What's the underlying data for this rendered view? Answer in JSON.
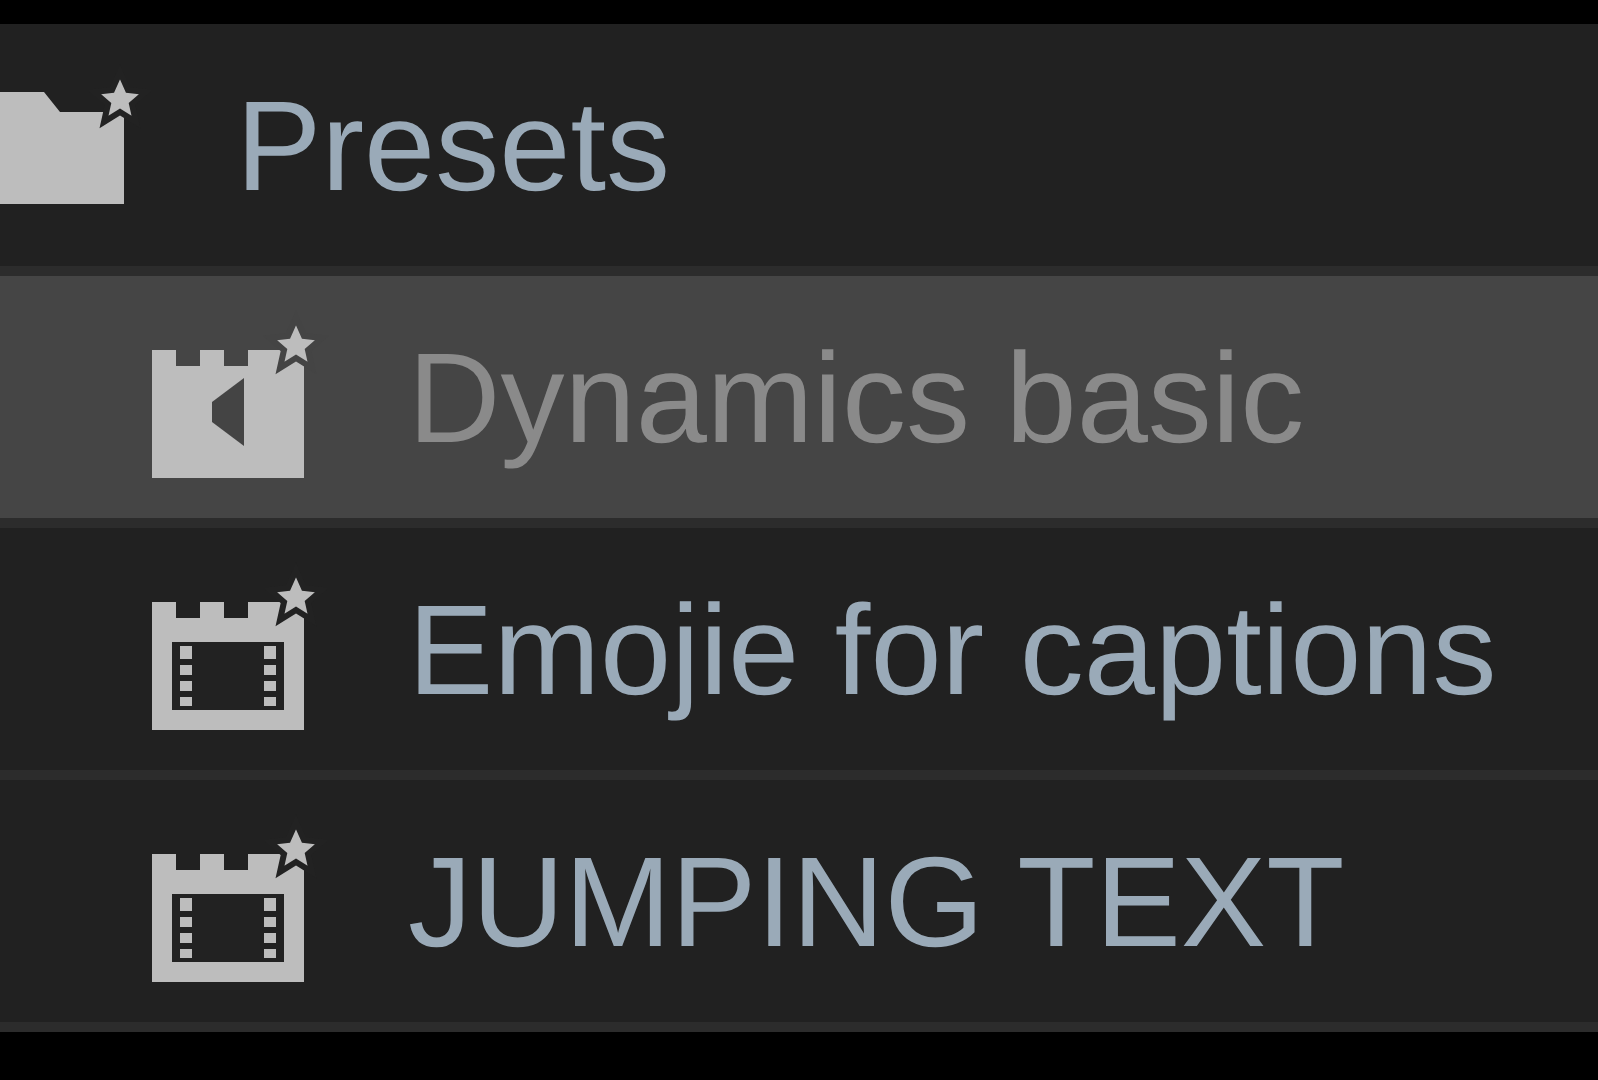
{
  "tree": {
    "label": "Presets",
    "kind": "folder",
    "selected": false,
    "children": [
      {
        "label": "Dynamics basic",
        "kind": "audio",
        "selected": true
      },
      {
        "label": "Emojie for captions",
        "kind": "video",
        "selected": false
      },
      {
        "label": "JUMPING TEXT",
        "kind": "video",
        "selected": false
      }
    ]
  }
}
